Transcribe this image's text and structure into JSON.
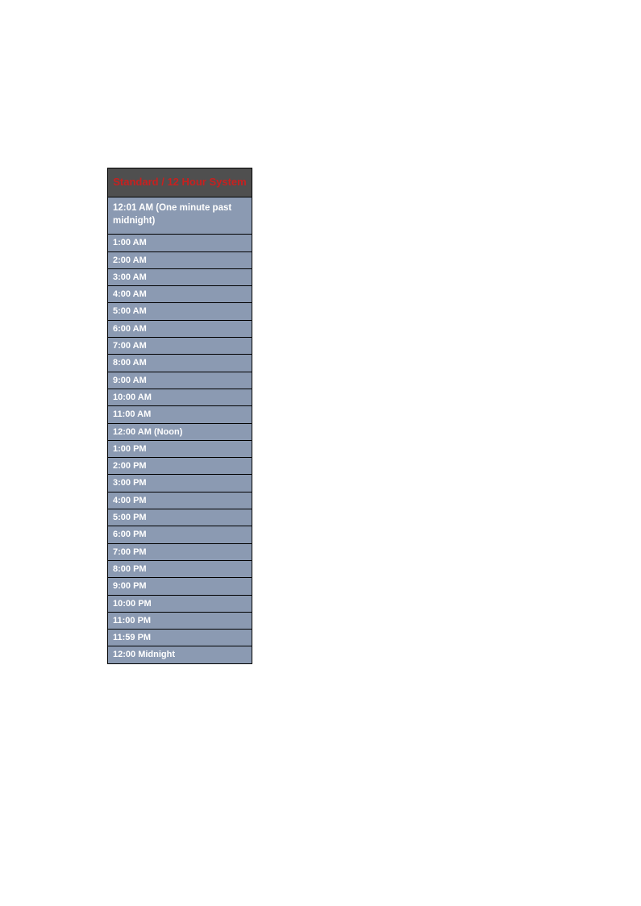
{
  "table": {
    "header": "Standard / 12 Hour System",
    "rows": [
      "12:01 AM (One minute past midnight)",
      "1:00 AM",
      "2:00 AM",
      "3:00 AM",
      "4:00 AM",
      "5:00 AM",
      "6:00 AM",
      "7:00 AM",
      "8:00 AM",
      "9:00 AM",
      "10:00 AM",
      "11:00 AM",
      "12:00 AM (Noon)",
      "1:00 PM",
      "2:00 PM",
      "3:00 PM",
      "4:00 PM",
      "5:00 PM",
      "6:00 PM",
      "7:00 PM",
      "8:00 PM",
      "9:00 PM",
      "10:00 PM",
      "11:00 PM",
      "11:59 PM",
      "12:00 Midnight"
    ]
  }
}
